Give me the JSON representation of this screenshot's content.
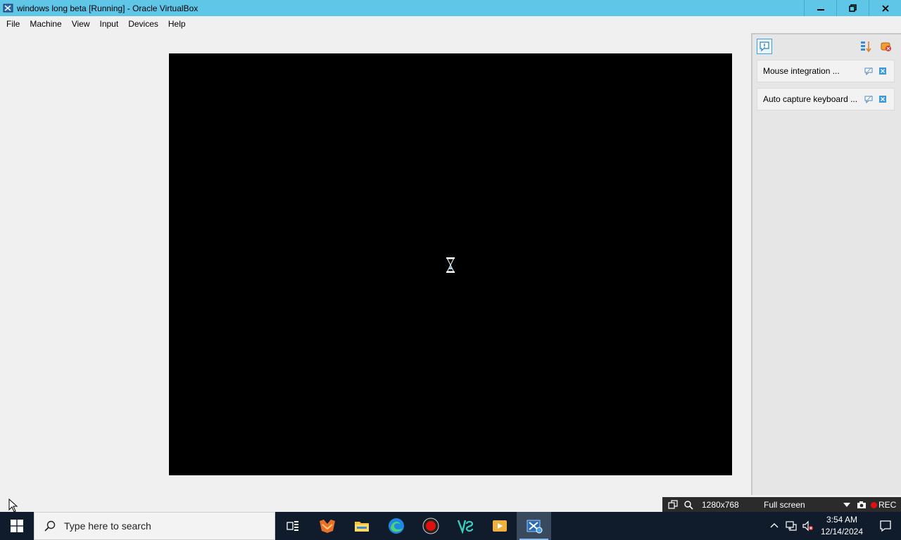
{
  "window": {
    "title": "windows long beta [Running] - Oracle VirtualBox"
  },
  "menu": {
    "items": [
      "File",
      "Machine",
      "View",
      "Input",
      "Devices",
      "Help"
    ]
  },
  "notifications": {
    "items": [
      {
        "label": "Mouse integration ..."
      },
      {
        "label": "Auto capture keyboard ..."
      }
    ]
  },
  "statusbar": {
    "resolution": "1280x768",
    "mode": "Full screen",
    "rec": "REC"
  },
  "taskbar": {
    "search_placeholder": "Type here to search",
    "time": "3:54 AM",
    "date": "12/14/2024"
  },
  "colors": {
    "titlebar": "#5fc6e8",
    "taskbar": "#101c2c",
    "vm_screen": "#000000"
  }
}
